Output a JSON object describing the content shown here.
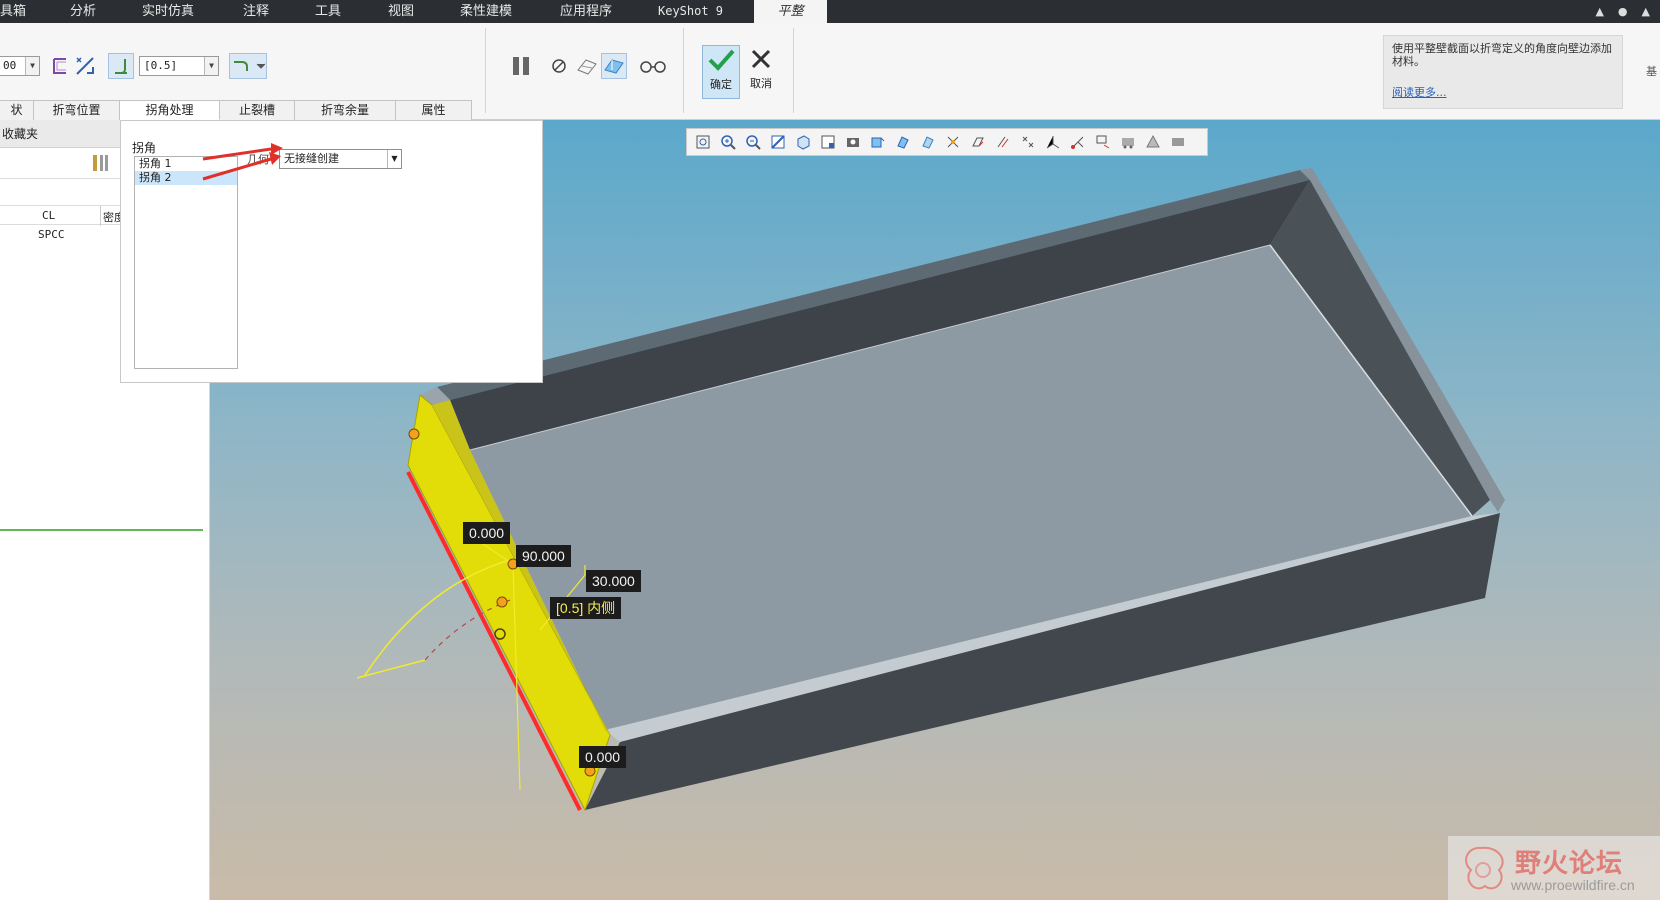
{
  "menubar": {
    "items": [
      "具箱",
      "分析",
      "实时仿真",
      "注释",
      "工具",
      "视图",
      "柔性建模",
      "应用程序",
      "KeyShot 9",
      "平整"
    ],
    "active": "平整"
  },
  "ribbon": {
    "select1_value": "00",
    "select2_value": "[0.5]",
    "ok_label": "确定",
    "cancel_label": "取消",
    "help_text": "使用平整壁截面以折弯定义的角度向壁边添加材料。",
    "help_link": "阅读更多...",
    "far_right_text": "基"
  },
  "tabs": [
    "状",
    "折弯位置",
    "拐角处理",
    "止裂槽",
    "折弯余量",
    "属性"
  ],
  "active_tab": "拐角处理",
  "left_panel": {
    "header": "收藏夹",
    "col_cl": "CL",
    "col_density": "密度",
    "row_value": "SPCC"
  },
  "popup": {
    "title": "拐角",
    "items": [
      "拐角 1",
      "拐角 2"
    ],
    "selected_index": 1,
    "field_label": "几何",
    "field_value": "无接缝创建"
  },
  "dimensions": {
    "top_offset": "0.000",
    "angle": "90.000",
    "angle2": "30.000",
    "thickness": "[0.5] 内侧",
    "bottom_offset": "0.000"
  },
  "watermark": {
    "title": "野火论坛",
    "url": "www.proewildfire.cn"
  },
  "colors": {
    "menubar_bg": "#2b2f33",
    "selected_face": "#e2dd08",
    "edge_highlight": "#ff2a2a",
    "viewport_top": "#5ba8cb",
    "viewport_bottom": "#c9bba8",
    "ok_button": "#cfe6f7"
  },
  "icons": [
    "search-icon",
    "zoom-in-icon",
    "zoom-out-icon",
    "refit-icon",
    "cube-icon",
    "saved-view-icon",
    "camera-icon",
    "pause-icon",
    "stop-icon",
    "eyeglasses-icon",
    "check-icon",
    "close-icon",
    "hammer-icon"
  ]
}
